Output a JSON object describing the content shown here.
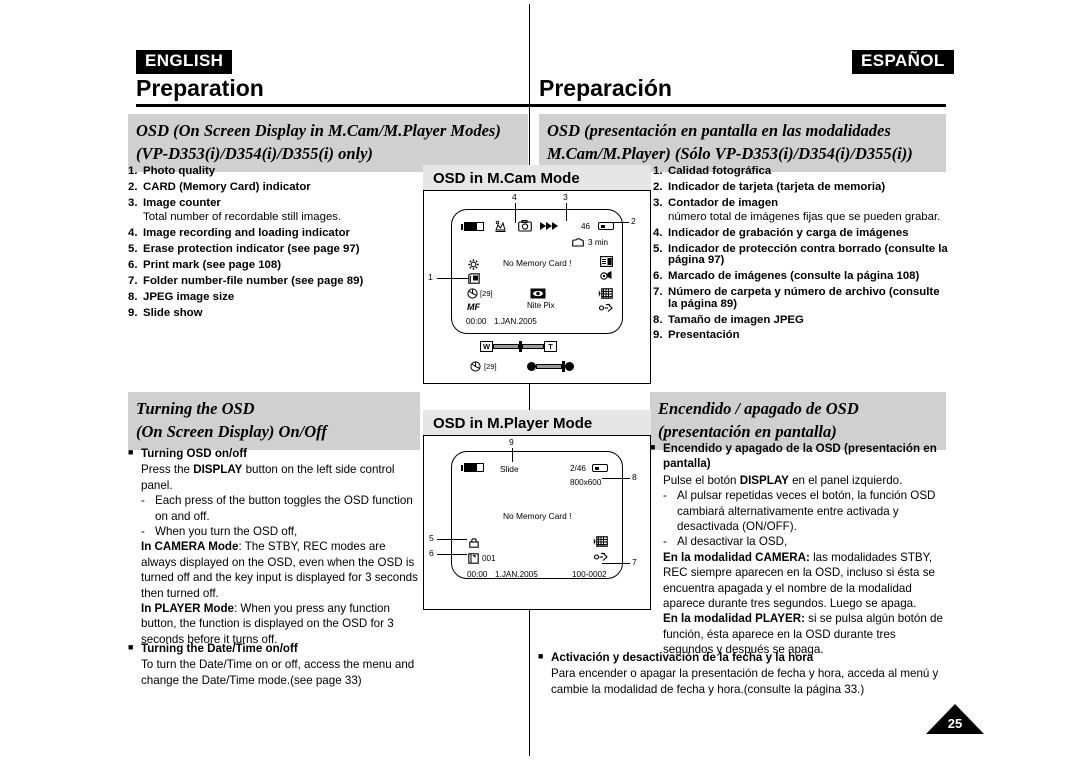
{
  "document": {
    "page_number": "25"
  },
  "left": {
    "language_badge": "ENGLISH",
    "chapter_title": "Preparation",
    "section_header_line1": "OSD (On Screen Display in M.Cam/M.Player Modes)",
    "section_header_line2": "(VP-D353(i)/D354(i)/D355(i) only)",
    "numbered_items": [
      {
        "n": "1.",
        "text": "Photo quality",
        "sub": ""
      },
      {
        "n": "2.",
        "text": "CARD (Memory Card) indicator",
        "sub": ""
      },
      {
        "n": "3.",
        "text": "Image counter",
        "sub": "Total number of recordable still images."
      },
      {
        "n": "4.",
        "text": "Image recording and loading indicator",
        "sub": ""
      },
      {
        "n": "5.",
        "text": "Erase protection indicator (see page 97)",
        "sub": ""
      },
      {
        "n": "6.",
        "text": "Print mark (see page 108)",
        "sub": ""
      },
      {
        "n": "7.",
        "text": "Folder number-file number (see page 89)",
        "sub": ""
      },
      {
        "n": "8.",
        "text": "JPEG image size",
        "sub": ""
      },
      {
        "n": "9.",
        "text": "Slide show",
        "sub": ""
      }
    ],
    "section2_header_line1": "Turning the OSD",
    "section2_header_line2": "(On Screen Display) On/Off",
    "osd_onoff": {
      "bullet_heading": "Turning OSD on/off",
      "line1_a": "Press the ",
      "line1_bold": "DISPLAY",
      "line1_b": " button on the left side control panel.",
      "dash1": "Each press of the button toggles the OSD function on and off.",
      "dash2": "When you turn the OSD off,",
      "camera_bold": "In CAMERA Mode",
      "camera_text": ": The STBY, REC modes are always displayed on the OSD, even when the OSD is turned off and the key input is displayed for 3 seconds then turned off.",
      "player_bold": "In PLAYER Mode",
      "player_text": ": When you press any function button, the function is displayed on the OSD for 3 seconds before it turns off."
    },
    "datetime": {
      "bullet_heading": "Turning the Date/Time on/off",
      "text": "To turn the Date/Time on or off, access the menu and change the Date/Time mode.(see page 33)"
    }
  },
  "right": {
    "language_badge": "ESPAÑOL",
    "chapter_title": "Preparación",
    "section_header_line1": "OSD (presentación en pantalla en las modalidades",
    "section_header_line2": "M.Cam/M.Player)  (Sólo VP-D353(i)/D354(i)/D355(i))",
    "numbered_items": [
      {
        "n": "1.",
        "text": "Calidad fotográfica",
        "sub": ""
      },
      {
        "n": "2.",
        "text": "Indicador de tarjeta (tarjeta de memoria)",
        "sub": ""
      },
      {
        "n": "3.",
        "text": "Contador de imagen",
        "sub": "número total de imágenes fijas que se pueden grabar."
      },
      {
        "n": "4.",
        "text": "Indicador de grabación y carga de imágenes",
        "sub": ""
      },
      {
        "n": "5.",
        "text": "Indicador de protección contra borrado (consulte la página 97)",
        "sub": ""
      },
      {
        "n": "6.",
        "text": "Marcado de imágenes (consulte la página 108)",
        "sub": ""
      },
      {
        "n": "7.",
        "text": "Número de carpeta y número de archivo (consulte la página 89)",
        "sub": ""
      },
      {
        "n": "8.",
        "text": "Tamaño de imagen JPEG",
        "sub": ""
      },
      {
        "n": "9.",
        "text": "Presentación",
        "sub": ""
      }
    ],
    "section2_header_line1": "Encendido / apagado de OSD",
    "section2_header_line2": "(presentación en pantalla)",
    "osd_onoff": {
      "bullet_heading": "Encendido y apagado de la OSD (presentación en pantalla)",
      "line1_a": "Pulse el botón ",
      "line1_bold": "DISPLAY",
      "line1_b": " en el panel izquierdo.",
      "dash1": "Al pulsar repetidas veces el botón, la función OSD cambiará alternativamente entre activada y desactivada (ON/OFF).",
      "dash2": "Al desactivar la OSD,",
      "camera_bold": "En la modalidad CAMERA:",
      "camera_text": " las modalidades STBY, REC siempre aparecen en la OSD, incluso si ésta se encuentra apagada y el nombre de la modalidad aparece durante tres segundos. Luego se apaga.",
      "player_bold": "En la modalidad PLAYER:",
      "player_text": " si se pulsa algún botón de función, ésta aparece en la OSD durante tres segundos y después se apaga."
    },
    "datetime": {
      "bullet_heading": "Activación y desactivación de la fecha y la hora",
      "text": "Para encender o apagar la presentación de fecha y hora, acceda al menú y cambie la modalidad de fecha y hora.(consulte la página 33.)"
    }
  },
  "diagrams": {
    "mcam": {
      "title": "OSD in M.Cam Mode",
      "callouts": [
        "1",
        "2",
        "3",
        "4"
      ],
      "osd": {
        "counter": "46",
        "time_remaining": "3 min",
        "center_message": "No Memory Card !",
        "nite_pix_label": "Nite Pix",
        "counter_bracket": "[29]",
        "manual_focus": "MF",
        "timestamp_time": "00:00",
        "timestamp_date": "1.JAN.2005",
        "zoom_wide": "W",
        "zoom_tele": "T",
        "bottom_counter": "[29]"
      }
    },
    "mplayer": {
      "title": "OSD in M.Player Mode",
      "callouts": [
        "5",
        "6",
        "7",
        "8",
        "9"
      ],
      "osd": {
        "slide_label": "Slide",
        "image_index": "2/46",
        "image_size": "800x600",
        "center_message": "No Memory Card !",
        "folder_number": "001",
        "timestamp_time": "00:00",
        "timestamp_date": "1.JAN.2005",
        "file_number": "100-0002"
      }
    }
  }
}
